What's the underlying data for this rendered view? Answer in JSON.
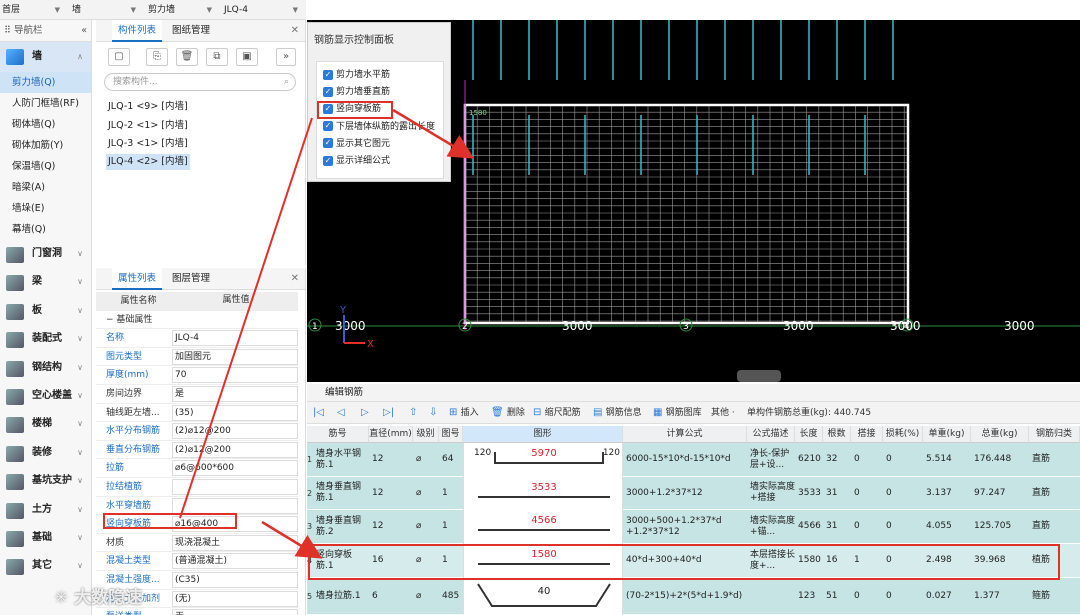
{
  "topbar": {
    "floor": "首层",
    "category": "墙",
    "subtype": "剪力墙",
    "component": "JLQ-4"
  },
  "nav": {
    "title": "导航栏",
    "wall_category": "墙",
    "wall_items": [
      "剪力墙(Q)",
      "人防门框墙(RF)",
      "砌体墙(Q)",
      "砌体加筋(Y)",
      "保温墙(Q)",
      "暗梁(A)",
      "墙垛(E)",
      "幕墙(Q)"
    ],
    "categories": [
      "门窗洞",
      "梁",
      "板",
      "装配式",
      "钢结构",
      "空心楼盖",
      "楼梯",
      "装修",
      "基坑支护",
      "土方",
      "基础",
      "其它"
    ]
  },
  "component_panel": {
    "tabs": [
      "构件列表",
      "图纸管理"
    ],
    "search_placeholder": "搜索构件...",
    "items": [
      "JLQ-1 <9> [内墙]",
      "JLQ-2 <1> [内墙]",
      "JLQ-3 <1> [内墙]",
      "JLQ-4 <2> [内墙]"
    ],
    "more_label": "»"
  },
  "property_panel": {
    "tabs": [
      "属性列表",
      "图层管理"
    ],
    "header_name": "属性名称",
    "header_value": "属性值",
    "section": "基础属性",
    "rows": [
      {
        "name": "名称",
        "value": "JLQ-4"
      },
      {
        "name": "图元类型",
        "value": "加固图元"
      },
      {
        "name": "厚度(mm)",
        "value": "70"
      },
      {
        "name": "房间边界",
        "value": "是"
      },
      {
        "name": "轴线距左墙...",
        "value": "(35)"
      },
      {
        "name": "水平分布钢筋",
        "value": "(2)⌀12@200"
      },
      {
        "name": "垂直分布钢筋",
        "value": "(2)⌀12@200"
      },
      {
        "name": "拉筋",
        "value": "⌀6@600*600"
      },
      {
        "name": "拉结植筋",
        "value": ""
      },
      {
        "name": "水平穿墙筋",
        "value": ""
      },
      {
        "name": "竖向穿板筋",
        "value": "⌀16@400"
      },
      {
        "name": "材质",
        "value": "现浇混凝土"
      },
      {
        "name": "混凝土类型",
        "value": "(普通混凝土)"
      },
      {
        "name": "混凝土强度...",
        "value": "(C35)"
      },
      {
        "name": "混凝土外加剂",
        "value": "(无)"
      },
      {
        "name": "泵送类型",
        "value": "无"
      }
    ]
  },
  "control_panel": {
    "title": "钢筋显示控制面板",
    "options": [
      "剪力墙水平筋",
      "剪力墙垂直筋",
      "竖向穿板筋",
      "下层墙体纵筋的露出长度",
      "显示其它图元",
      "显示详细公式"
    ]
  },
  "cad": {
    "axis_labels": [
      "1",
      "2",
      "3",
      "4"
    ],
    "dimensions": [
      "3000",
      "3000",
      "3000",
      "3000",
      "3000"
    ],
    "green_label": "1580",
    "x_label": "X",
    "y_label": "Y"
  },
  "rebar_editor": {
    "title": "编辑钢筋",
    "toolbar": [
      "插入",
      "删除",
      "缩尺配筋",
      "钢筋信息",
      "钢筋图库",
      "其他 ·",
      "单构件钢筋总重(kg): 440.745"
    ],
    "columns": [
      "筋号",
      "直径(mm)",
      "级别",
      "图号",
      "图形",
      "计算公式",
      "公式描述",
      "长度",
      "根数",
      "搭接",
      "损耗(%)",
      "单重(kg)",
      "总重(kg)",
      "钢筋归类"
    ],
    "rows": [
      {
        "idx": "1",
        "name": "墙身水平钢筋.1",
        "dia": "12",
        "grade": "⌀",
        "fig": "64",
        "shape_left": "120",
        "shape_value": "5970",
        "shape_right": "120",
        "formula": "6000-15*10*d-15*10*d",
        "desc": "净长-保护层+设...",
        "length": "6210",
        "count": "32",
        "lap": "0",
        "loss": "0",
        "unit_w": "5.514",
        "total_w": "176.448",
        "cls": "直筋"
      },
      {
        "idx": "2",
        "name": "墙身垂直钢筋.1",
        "dia": "12",
        "grade": "⌀",
        "fig": "1",
        "shape_left": "",
        "shape_value": "3533",
        "shape_right": "",
        "formula": "3000+1.2*37*12",
        "desc": "墙实际高度+搭接",
        "length": "3533",
        "count": "31",
        "lap": "0",
        "loss": "0",
        "unit_w": "3.137",
        "total_w": "97.247",
        "cls": "直筋"
      },
      {
        "idx": "3",
        "name": "墙身垂直钢筋.2",
        "dia": "12",
        "grade": "⌀",
        "fig": "1",
        "shape_left": "",
        "shape_value": "4566",
        "shape_right": "",
        "formula": "3000+500+1.2*37*d +1.2*37*12",
        "desc": "墙实际高度+锚...",
        "length": "4566",
        "count": "31",
        "lap": "0",
        "loss": "0",
        "unit_w": "4.055",
        "total_w": "125.705",
        "cls": "直筋"
      },
      {
        "idx": "4",
        "name": "竖向穿板筋.1",
        "dia": "16",
        "grade": "⌀",
        "fig": "1",
        "shape_left": "",
        "shape_value": "1580",
        "shape_right": "",
        "formula": "40*d+300+40*d",
        "desc": "本层搭接长度+...",
        "length": "1580",
        "count": "16",
        "lap": "1",
        "loss": "0",
        "unit_w": "2.498",
        "total_w": "39.968",
        "cls": "植筋"
      },
      {
        "idx": "5",
        "name": "墙身拉筋.1",
        "dia": "6",
        "grade": "⌀",
        "fig": "485",
        "shape_left": "",
        "shape_value": "40",
        "shape_right": "",
        "formula": "(70-2*15)+2*(5*d+1.9*d)",
        "desc": "",
        "length": "123",
        "count": "51",
        "lap": "0",
        "loss": "0",
        "unit_w": "0.027",
        "total_w": "1.377",
        "cls": "箍筋"
      }
    ]
  },
  "watermark": "大数隐速",
  "colors": {
    "accent": "#1a6ec2",
    "highlight": "#e0302a",
    "rebar": "#2fc4c9",
    "grid": "#ffffff",
    "axis": "#2e8b3e"
  }
}
